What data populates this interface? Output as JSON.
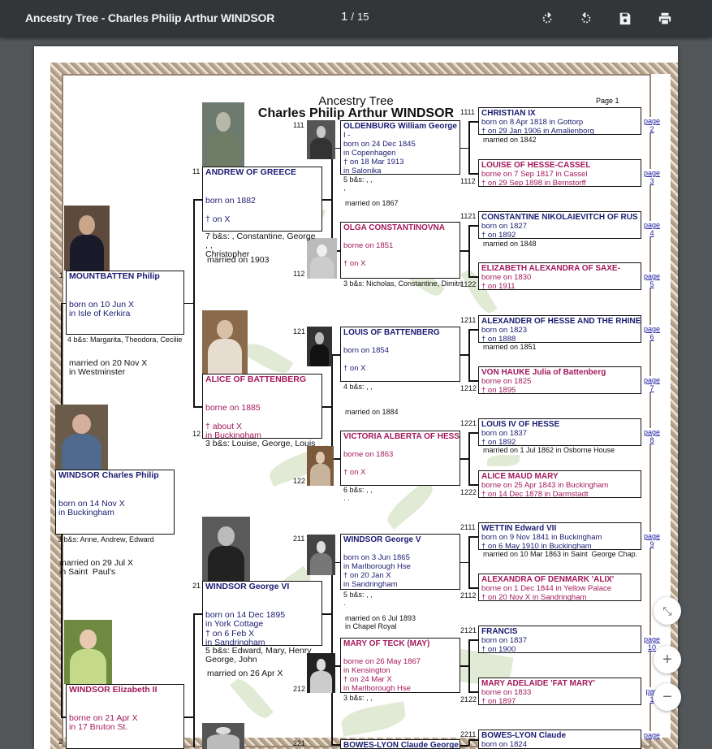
{
  "toolbar": {
    "title": "Ancestry Tree - Charles Philip Arthur WINDSOR",
    "current_page": "1",
    "separator": "/",
    "total_pages": "15",
    "buttons": [
      {
        "name": "rotate-clockwise-icon",
        "label": "Rotate clockwise"
      },
      {
        "name": "rotate-counterclockwise-icon",
        "label": "Rotate counterclockwise"
      },
      {
        "name": "download-icon",
        "label": "Download"
      },
      {
        "name": "print-icon",
        "label": "Print"
      }
    ]
  },
  "document": {
    "heading": "Ancestry Tree",
    "subject": "Charles Philip Arthur WINDSOR",
    "page_label": "Page 1",
    "colors": {
      "male": "#1b1b72",
      "female": "#a3195b",
      "page_link": "#1a1aa0"
    },
    "persons": [
      {
        "id": "root",
        "num": "",
        "sex": "m",
        "name": "WINDSOR Charles Philip",
        "lines": [
          "",
          "",
          "born on 14 Nov X",
          "in Buckingham"
        ]
      },
      {
        "id": "1",
        "num": "1",
        "sex": "m",
        "name": "MOUNTBATTEN Philip",
        "lines": [
          "",
          "",
          "born on 10 Jun X",
          "in Isle of Kerkira"
        ]
      },
      {
        "id": "2",
        "num": "2",
        "sex": "f",
        "name": "WINDSOR Elizabeth II",
        "lines": [
          "",
          "",
          "borne on 21 Apr X",
          "in 17 Bruton St."
        ]
      },
      {
        "id": "11",
        "num": "11",
        "sex": "m",
        "name": "ANDREW OF GREECE",
        "lines": [
          "",
          "",
          "born on 1882",
          "",
          "† on X"
        ]
      },
      {
        "id": "12",
        "num": "12",
        "sex": "f",
        "name": "ALICE OF BATTENBERG",
        "lines": [
          "",
          "",
          "borne on 1885",
          "",
          "† about    X",
          "in Buckingham"
        ]
      },
      {
        "id": "21",
        "num": "21",
        "sex": "m",
        "name": "WINDSOR George VI",
        "lines": [
          "",
          "",
          "born on 14 Dec 1895",
          "in York Cottage",
          "† on 6 Feb X",
          "in Sandringham"
        ]
      },
      {
        "id": "111",
        "num": "111",
        "sex": "m",
        "name": "OLDENBURG William George",
        "lines": [
          "I -",
          "born on 24 Dec 1845",
          "in Copenhagen",
          "† on 18 Mar 1913",
          "in Salonika"
        ]
      },
      {
        "id": "112",
        "num": "112",
        "sex": "f",
        "name": "OLGA CONSTANTINOVNA",
        "lines": [
          "",
          "borne on 1851",
          "",
          "† on X"
        ]
      },
      {
        "id": "121",
        "num": "121",
        "sex": "m",
        "name": "LOUIS OF BATTENBERG",
        "lines": [
          "",
          "born on 1854",
          "",
          "† on X"
        ]
      },
      {
        "id": "122",
        "num": "122",
        "sex": "f",
        "name": "VICTORIA ALBERTA OF HESSE",
        "lines": [
          "",
          "borne on 1863",
          "",
          "† on X"
        ]
      },
      {
        "id": "211",
        "num": "211",
        "sex": "m",
        "name": "WINDSOR George V",
        "lines": [
          "",
          "born on 3 Jun 1865",
          "in Marlborough Hse",
          "† on 20 Jan X",
          "in Sandringham"
        ]
      },
      {
        "id": "212",
        "num": "212",
        "sex": "f",
        "name": "MARY OF TECK (MAY)",
        "lines": [
          "",
          "borne on 26 May 1867",
          "in Kensington",
          "† on 24 Mar X",
          "in Marlborough Hse"
        ]
      },
      {
        "id": "221",
        "num": "221",
        "sex": "m",
        "name": "BOWES-LYON Claude George",
        "lines": []
      },
      {
        "id": "1111",
        "num": "1111",
        "sex": "m",
        "name": "CHRISTIAN IX",
        "lines": [
          "born on 8 Apr 1818 in Gottorp",
          "† on 29 Jan 1906 in Amalienborg"
        ],
        "page_link": [
          "page",
          "2"
        ]
      },
      {
        "id": "1112",
        "num": "1112",
        "sex": "f",
        "name": "LOUISE OF HESSE-CASSEL",
        "lines": [
          "borne on 7 Sep 1817 in Cassel",
          "† on 29 Sep 1898 in Bernstorff"
        ],
        "page_link": [
          "page",
          "3"
        ]
      },
      {
        "id": "1121",
        "num": "1121",
        "sex": "m",
        "name": "CONSTANTINE NIKOLAIEVITCH OF RUS",
        "lines": [
          "born on 1827",
          "† on 1892"
        ],
        "page_link": [
          "page",
          "4"
        ]
      },
      {
        "id": "1122",
        "num": "1122",
        "sex": "f",
        "name": "ELIZABETH ALEXANDRA OF SAXE-",
        "lines": [
          "borne on 1830",
          "† on 1911"
        ],
        "page_link": [
          "page",
          "5"
        ]
      },
      {
        "id": "1211",
        "num": "1211",
        "sex": "m",
        "name": "ALEXANDER OF HESSE AND THE RHINE",
        "lines": [
          "born on 1823",
          "† on 1888"
        ],
        "page_link": [
          "page",
          "6"
        ]
      },
      {
        "id": "1212",
        "num": "1212",
        "sex": "f",
        "name": "VON HAUKE Julia of Battenberg",
        "lines": [
          "borne on 1825",
          "† on 1895"
        ],
        "page_link": [
          "page",
          "7"
        ]
      },
      {
        "id": "1221",
        "num": "1221",
        "sex": "m",
        "name": "LOUIS IV OF HESSE",
        "lines": [
          "born on 1837",
          "† on 1892"
        ],
        "page_link": [
          "page",
          "8"
        ]
      },
      {
        "id": "1222",
        "num": "1222",
        "sex": "f",
        "name": "ALICE MAUD MARY",
        "lines": [
          "borne on 25 Apr 1843 in Buckingham",
          "† on 14 Dec 1878 in Darmstadt"
        ]
      },
      {
        "id": "2111",
        "num": "2111",
        "sex": "m",
        "name": "WETTIN Edward VII",
        "lines": [
          "born on 9 Nov 1841 in Buckingham",
          "† on 6 May 1910 in Buckingham"
        ],
        "page_link": [
          "page",
          "9"
        ]
      },
      {
        "id": "2112",
        "num": "2112",
        "sex": "f",
        "name": "ALEXANDRA OF DENMARK 'ALIX'",
        "lines": [
          "borne on 1 Dec 1844 in Yellow Palace",
          "† on 20 Nov X in Sandringham"
        ]
      },
      {
        "id": "2121",
        "num": "2121",
        "sex": "m",
        "name": "FRANCIS",
        "lines": [
          "born on 1837",
          "† on 1900"
        ],
        "page_link": [
          "page",
          "10"
        ]
      },
      {
        "id": "2122",
        "num": "2122",
        "sex": "f",
        "name": "MARY ADELAIDE 'FAT MARY'",
        "lines": [
          "borne on 1833",
          "† on 1897"
        ],
        "page_link": [
          "pag",
          "1"
        ]
      },
      {
        "id": "2211",
        "num": "2211",
        "sex": "m",
        "name": "BOWES-LYON Claude",
        "lines": [
          "born on 1824"
        ],
        "page_link": [
          "page",
          ""
        ]
      }
    ],
    "notes": [
      "married on 1842",
      "married on 1848",
      "married on 1851",
      "married on 1 Jul 1862 in Osborne House",
      "married on 10 Mar 1863 in Saint  George Chap.",
      "5 b&s: , ,\n,",
      "married on 1867",
      "3 b&s: Nicholas, Constantine, Dimitri",
      "4 b&s: , ,",
      "married on 1884",
      "6 b&s: , ,\n. .",
      "5 b&s: , ,\n.",
      "married on 6 Jul 1893\nin Chapel Royal",
      "3 b&s: , ,",
      "7 b&s: , Constantine, George\n, ,\nChristopher",
      "married on 1903",
      "3 b&s: Louise, George, Louis",
      "5 b&s: Edward, Mary, Henry\nGeorge, John",
      "married on 26 Apr X",
      "4 b&s: Margarita, Theodora, Cecilie",
      "married on 20 Nov X\nin Westminster",
      "3 b&s: Anne, Andrew, Edward",
      "married on 29 Jul X\nin Saint  Paul's"
    ]
  },
  "zoom_controls": [
    {
      "name": "fit-page-icon",
      "glyph": "⤡"
    },
    {
      "name": "zoom-in-icon",
      "glyph": "+"
    },
    {
      "name": "zoom-out-icon",
      "glyph": "−"
    }
  ]
}
